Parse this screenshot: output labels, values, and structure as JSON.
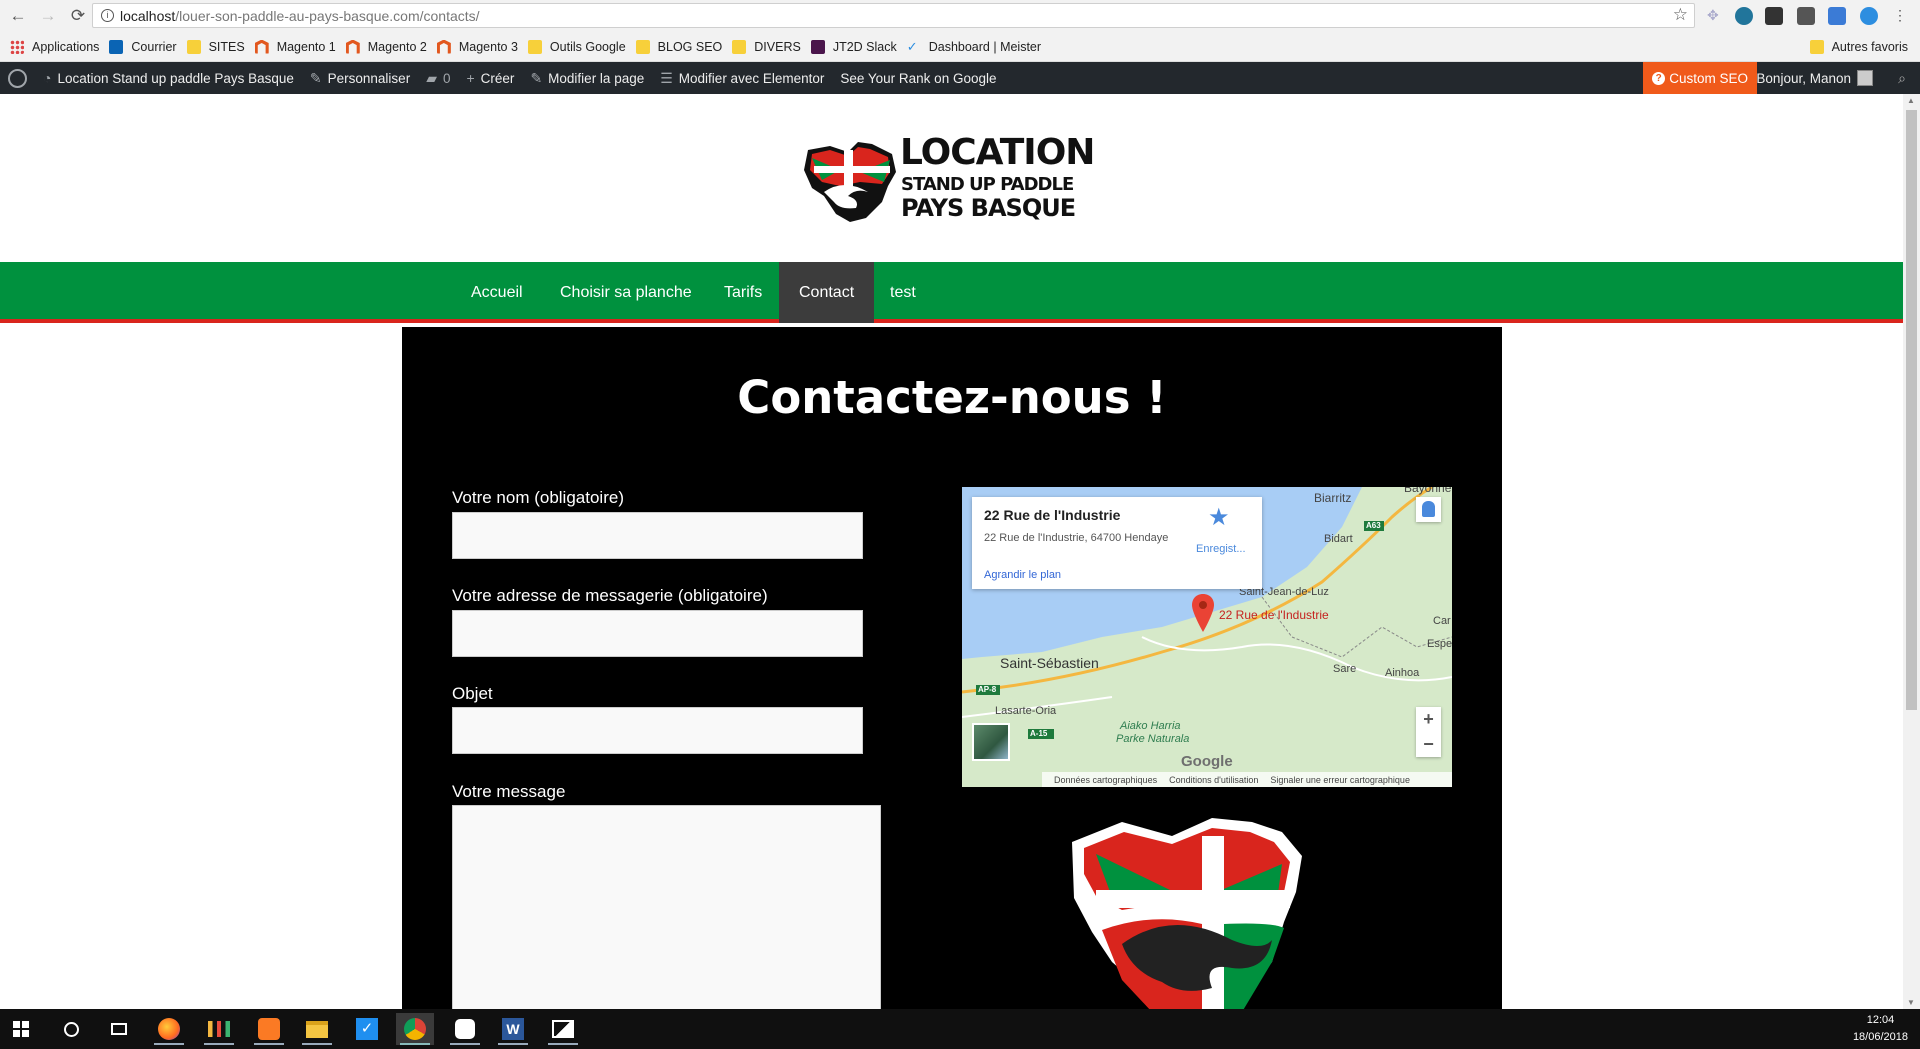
{
  "browser": {
    "url_host": "localhost",
    "url_path": "/louer-son-paddle-au-pays-basque.com/contacts/",
    "bookmarks": [
      "Applications",
      "Courrier",
      "SITES",
      "Magento 1",
      "Magento 2",
      "Magento 3",
      "Outils Google",
      "BLOG SEO",
      "DIVERS",
      "JT2D Slack",
      "Dashboard | Meister"
    ],
    "other_bookmarks": "Autres favoris"
  },
  "wpbar": {
    "site": "Location Stand up paddle Pays Basque",
    "customize": "Personnaliser",
    "comments": "0",
    "new": "Créer",
    "edit_page": "Modifier la page",
    "elementor": "Modifier avec Elementor",
    "rank": "See Your Rank on Google",
    "custom_seo": "Custom SEO",
    "greeting": "Bonjour, Manon"
  },
  "logo": {
    "line1": "LOCATION",
    "line2": "STAND UP PADDLE",
    "line3": "PAYS BASQUE"
  },
  "nav": [
    "Accueil",
    "Choisir sa planche",
    "Tarifs",
    "Contact",
    "test"
  ],
  "page": {
    "title": "Contactez-nous !",
    "form": {
      "name_label": "Votre nom (obligatoire)",
      "email_label": "Votre adresse de messagerie (obligatoire)",
      "subject_label": "Objet",
      "message_label": "Votre message"
    }
  },
  "map": {
    "place_title": "22 Rue de l'Industrie",
    "place_address": "22 Rue de l'Industrie, 64700 Hendaye",
    "save": "Enregist...",
    "enlarge": "Agrandir le plan",
    "pin_label": "22 Rue de l'Industrie",
    "towns": [
      "Biarritz",
      "Bayonne",
      "Bidart",
      "Saint-Jean-de-Luz",
      "Saint-Sébastien",
      "Lasarte-Oria",
      "Aiako Harria",
      "Parke Naturala",
      "Sare",
      "Ainhoa",
      "Espele",
      "Car"
    ],
    "roads": [
      "A63",
      "AP-8",
      "A-15"
    ],
    "zoom_in": "+",
    "zoom_out": "−",
    "google": "Google",
    "footer": [
      "Données cartographiques",
      "Conditions d'utilisation",
      "Signaler une erreur cartographique"
    ]
  },
  "taskbar": {
    "time": "12:04",
    "date": "18/06/2018"
  },
  "colors": {
    "nav_green": "#00913e",
    "nav_red": "#d9251d",
    "custom_seo": "#f05a1a"
  }
}
